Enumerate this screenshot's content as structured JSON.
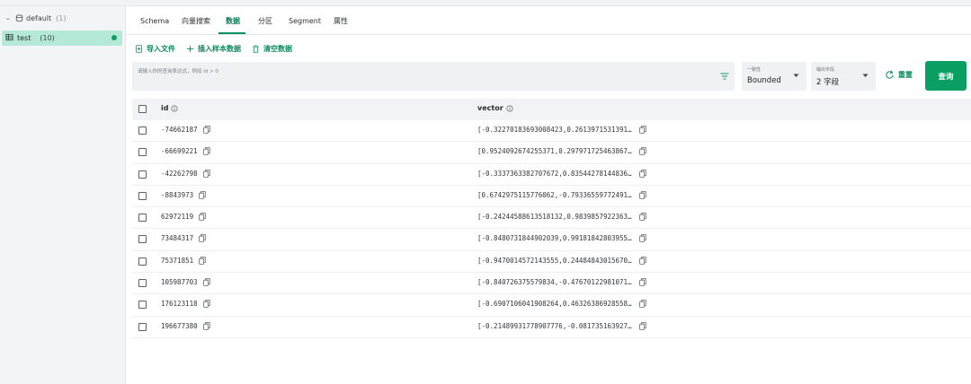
{
  "sidebar": {
    "database": {
      "name": "default",
      "count": "(1)"
    },
    "collection": {
      "name": "test",
      "count": "(10)"
    }
  },
  "tabs": [
    {
      "label": "Schema"
    },
    {
      "label": "向量搜索"
    },
    {
      "label": "数据"
    },
    {
      "label": "分区"
    },
    {
      "label": "Segment"
    },
    {
      "label": "属性"
    }
  ],
  "active_tab": "数据",
  "actions": {
    "import": "导入文件",
    "insert_sample": "插入样本数据",
    "clear": "清空数据"
  },
  "query": {
    "placeholder": "请输入你的查询表达式，例如 id > 0",
    "consistency_label": "一致性",
    "consistency_value": "Bounded",
    "output_label": "输出字段",
    "output_value": "2 字段",
    "reset_label": "重置",
    "query_label": "查询"
  },
  "table": {
    "headers": {
      "id": "id",
      "vector": "vector"
    },
    "rows": [
      {
        "id": "-74662187",
        "vector": "[-0.32270183693008423,0.2613971531391…"
      },
      {
        "id": "-66699221",
        "vector": "[0.9524092674255371,0.297971725463867…"
      },
      {
        "id": "-42262798",
        "vector": "[-0.3337363382707672,0.83544278144836…"
      },
      {
        "id": "-8843973",
        "vector": "[0.6742975115776062,-0.79336559772491…"
      },
      {
        "id": "62972119",
        "vector": "[-0.24244588613518132,0.9839857922363…"
      },
      {
        "id": "73484317",
        "vector": "[-0.8480731844902039,0.99181842803955…"
      },
      {
        "id": "75371851",
        "vector": "[-0.9470014572143555,0.24484843015670…"
      },
      {
        "id": "105987703",
        "vector": "[-0.840726375579834,-0.47670122981071…"
      },
      {
        "id": "176123118",
        "vector": "[-0.6907106041908264,0.46326386928558…"
      },
      {
        "id": "196677380",
        "vector": "[-0.21489931778907776,-0.081735163927…"
      }
    ]
  },
  "colors": {
    "accent": "#0b9e63",
    "selected_bg": "#b5e9d7",
    "panel_bg": "#eff1f3"
  },
  "icons": {
    "database": "database-icon",
    "collection": "table-icon",
    "copy": "copy-icon",
    "info": "info-icon",
    "filter": "filter-icon",
    "reset": "refresh-icon"
  }
}
